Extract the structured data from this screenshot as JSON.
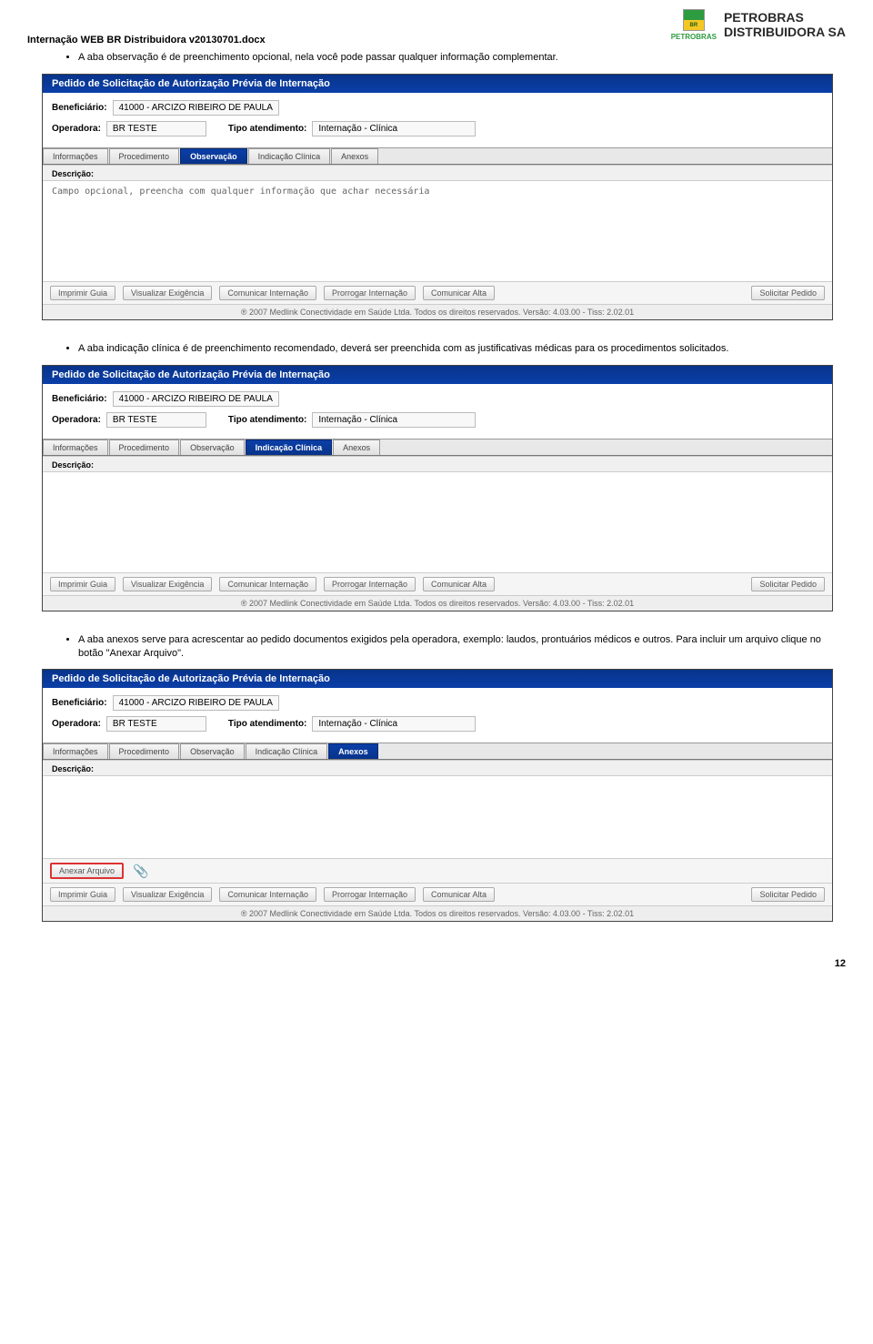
{
  "header": {
    "doc_title": "Internação WEB BR Distribuidora v20130701.docx",
    "company_line1": "PETROBRAS",
    "company_line2": "DISTRIBUIDORA SA",
    "logo_sub": "PETROBRAS"
  },
  "bullets": {
    "b1": "A aba observação é de preenchimento opcional, nela você pode passar qualquer informação complementar.",
    "b2": "A aba indicação clínica é de preenchimento recomendado, deverá ser preenchida com as justificativas médicas para os procedimentos solicitados.",
    "b3": "A aba anexos serve para acrescentar ao pedido documentos exigidos pela operadora, exemplo: laudos, prontuários médicos e outros. Para incluir um arquivo clique no botão \"Anexar Arquivo\"."
  },
  "panel": {
    "title": "Pedido de Solicitação de Autorização Prévia de Internação",
    "beneficiario_label": "Beneficiário:",
    "beneficiario_value": "41000 - ARCIZO RIBEIRO DE PAULA",
    "operadora_label": "Operadora:",
    "operadora_value": "BR TESTE",
    "tipo_label": "Tipo atendimento:",
    "tipo_value": "Internação - Clínica",
    "tabs": {
      "informacoes": "Informações",
      "procedimento": "Procedimento",
      "observacao": "Observação",
      "indicacao": "Indicação Clínica",
      "anexos": "Anexos"
    },
    "descricao_label": "Descrição:",
    "descricao_placeholder": "Campo opcional, preencha com qualquer informação que achar necessária",
    "buttons": {
      "imprimir": "Imprimir Guia",
      "visualizar": "Visualizar Exigência",
      "comunicar_int": "Comunicar Internação",
      "prorrogar": "Prorrogar Internação",
      "comunicar_alta": "Comunicar Alta",
      "solicitar": "Solicitar Pedido",
      "anexar": "Anexar Arquivo"
    },
    "footer": "® 2007  Medlink Conectividade em Saúde Ltda.   Todos os direitos reservados.   Versão: 4.03.00 - Tiss: 2.02.01"
  },
  "page_number": "12"
}
